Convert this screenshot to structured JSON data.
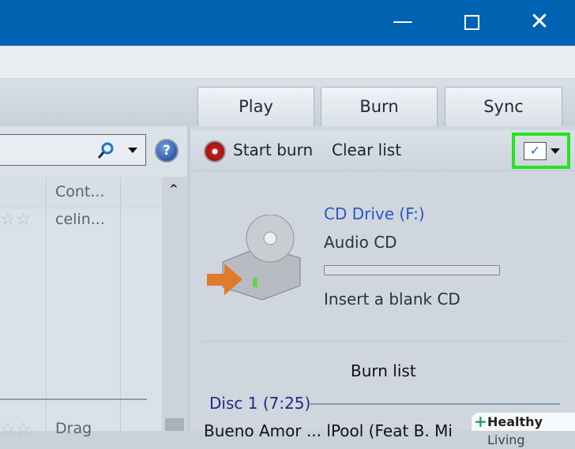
{
  "window": {
    "minimize_icon": "minimize-icon",
    "maximize_icon": "maximize-icon",
    "close_icon": "close-icon"
  },
  "tabs": [
    {
      "label": "Play"
    },
    {
      "label": "Burn"
    },
    {
      "label": "Sync"
    }
  ],
  "library": {
    "columns": [
      "Cont..."
    ],
    "rows": [
      {
        "rating": "☆☆",
        "contributor": "celin..."
      },
      {
        "rating": "☆☆",
        "contributor": "Drag"
      }
    ]
  },
  "burn": {
    "toolbar": {
      "start_burn": "Start burn",
      "clear_list": "Clear list"
    },
    "drive": {
      "name": "CD Drive (F:)",
      "type": "Audio CD",
      "progress": 0,
      "status": "Insert a blank CD"
    },
    "list_title": "Burn list",
    "disc": "Disc 1 (7:25)",
    "first_track": "Bueno Amor ... lPool (Feat B. Mi"
  },
  "watermark": {
    "brand": "Healthy",
    "brand2": "Living"
  },
  "colors": {
    "titlebar": "#0063b1",
    "highlight": "#22e51c",
    "link": "#2a56c6"
  }
}
